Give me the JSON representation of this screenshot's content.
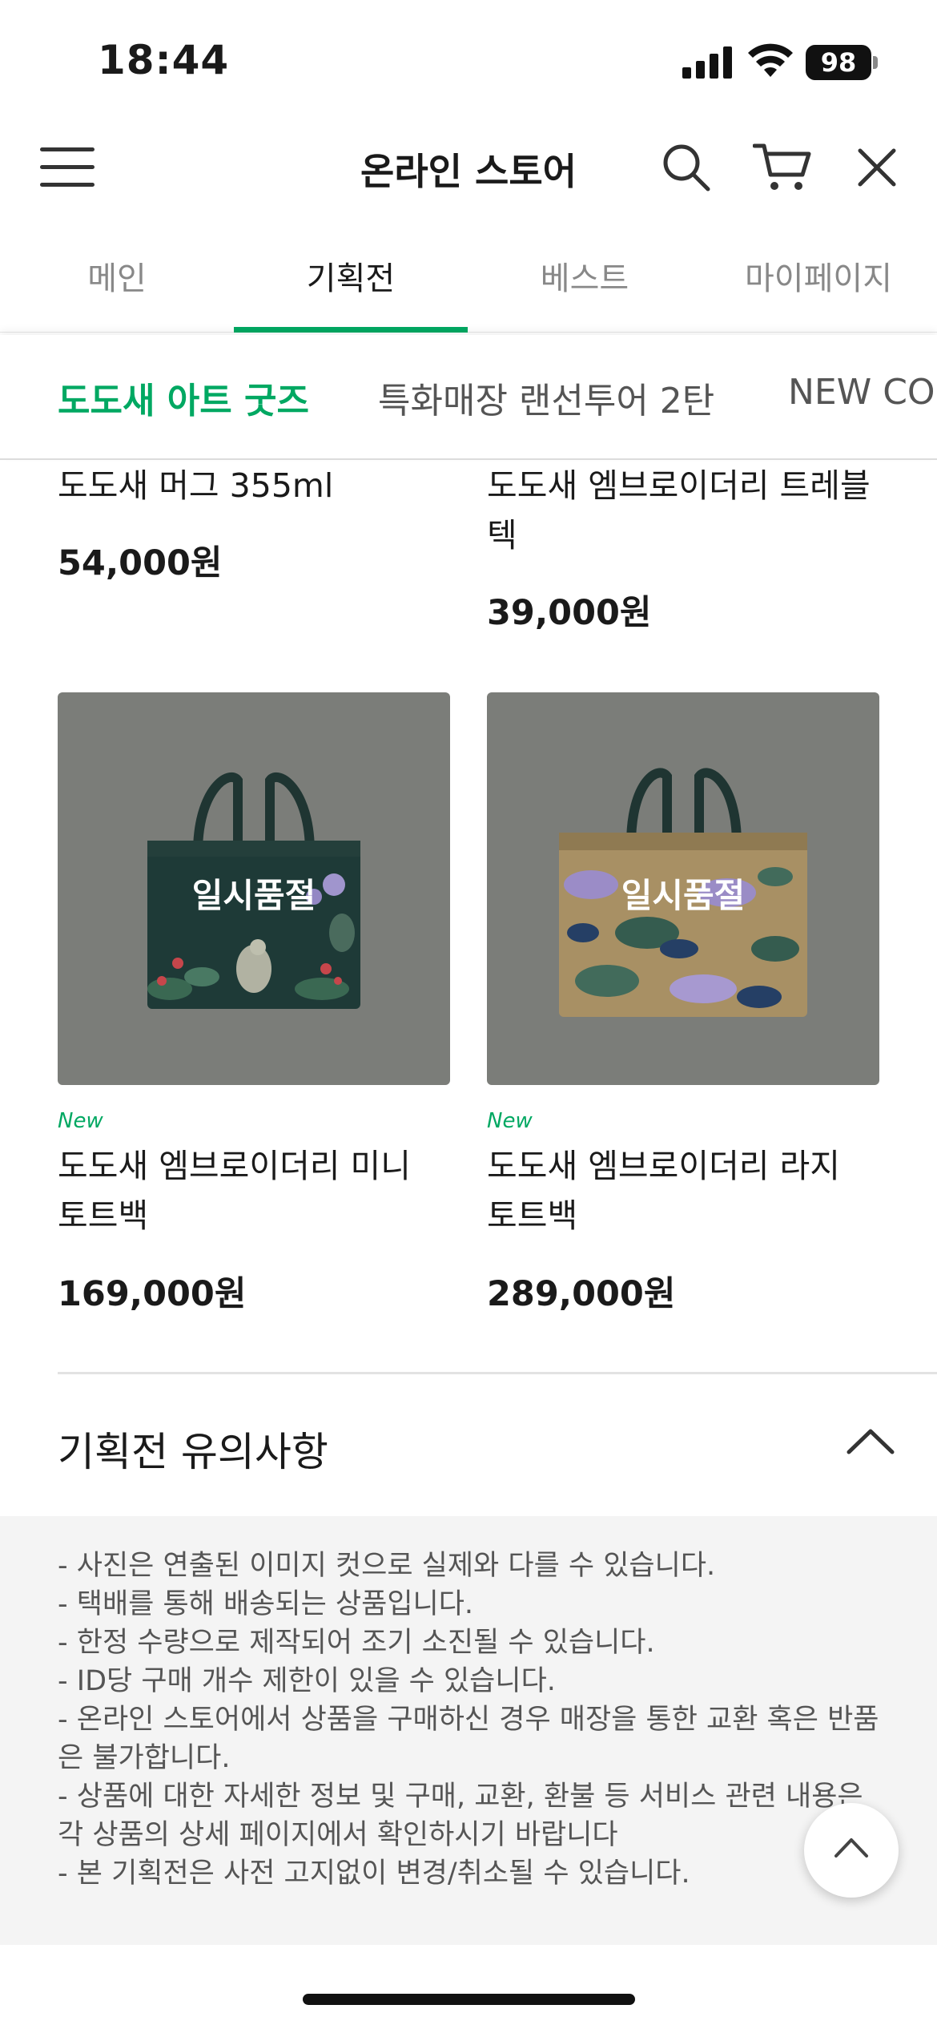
{
  "status_bar": {
    "time": "18:44",
    "battery": "98"
  },
  "header": {
    "title": "온라인 스토어"
  },
  "main_tabs": [
    "메인",
    "기획전",
    "베스트",
    "마이페이지"
  ],
  "sub_tabs": [
    "도도새 아트 굿즈",
    "특화매장 랜선투어 2탄",
    "NEW COLLECTION"
  ],
  "products": [
    {
      "name": "도도새 머그 355ml",
      "price": "54,000원"
    },
    {
      "name": "도도새 엠브로이더리 트레블텍",
      "name_line1": "도도새 엠브로이더리 트레블",
      "name_line2": "텍",
      "price": "39,000원"
    },
    {
      "badge": "New",
      "name_line1": "도도새 엠브로이더리 미니",
      "name_line2": "토트백",
      "price": "169,000원",
      "status": "일시품절"
    },
    {
      "badge": "New",
      "name_line1": "도도새 엠브로이더리 라지",
      "name_line2": "토트백",
      "price": "289,000원",
      "status": "일시품절"
    }
  ],
  "notice": {
    "title": "기획전 유의사항",
    "lines": [
      "- 사진은 연출된 이미지 컷으로 실제와 다를 수 있습니다.",
      "- 택배를 통해 배송되는 상품입니다.",
      "- 한정 수량으로 제작되어 조기 소진될 수 있습니다.",
      "- ID당 구매 개수 제한이 있을 수 있습니다.",
      "- 온라인 스토어에서 상품을 구매하신 경우 매장을 통한 교환 혹은 반품",
      "은 불가합니다.",
      "- 상품에 대한 자세한 정보 및 구매, 교환, 환불 등 서비스 관련 내용은",
      "각 상품의 상세 페이지에서 확인하시기 바랍니다",
      "- 본 기획전은 사전 고지없이 변경/취소될 수 있습니다."
    ]
  },
  "colors": {
    "accent": "#00a862",
    "thumb_bg": "#7b7d79"
  }
}
